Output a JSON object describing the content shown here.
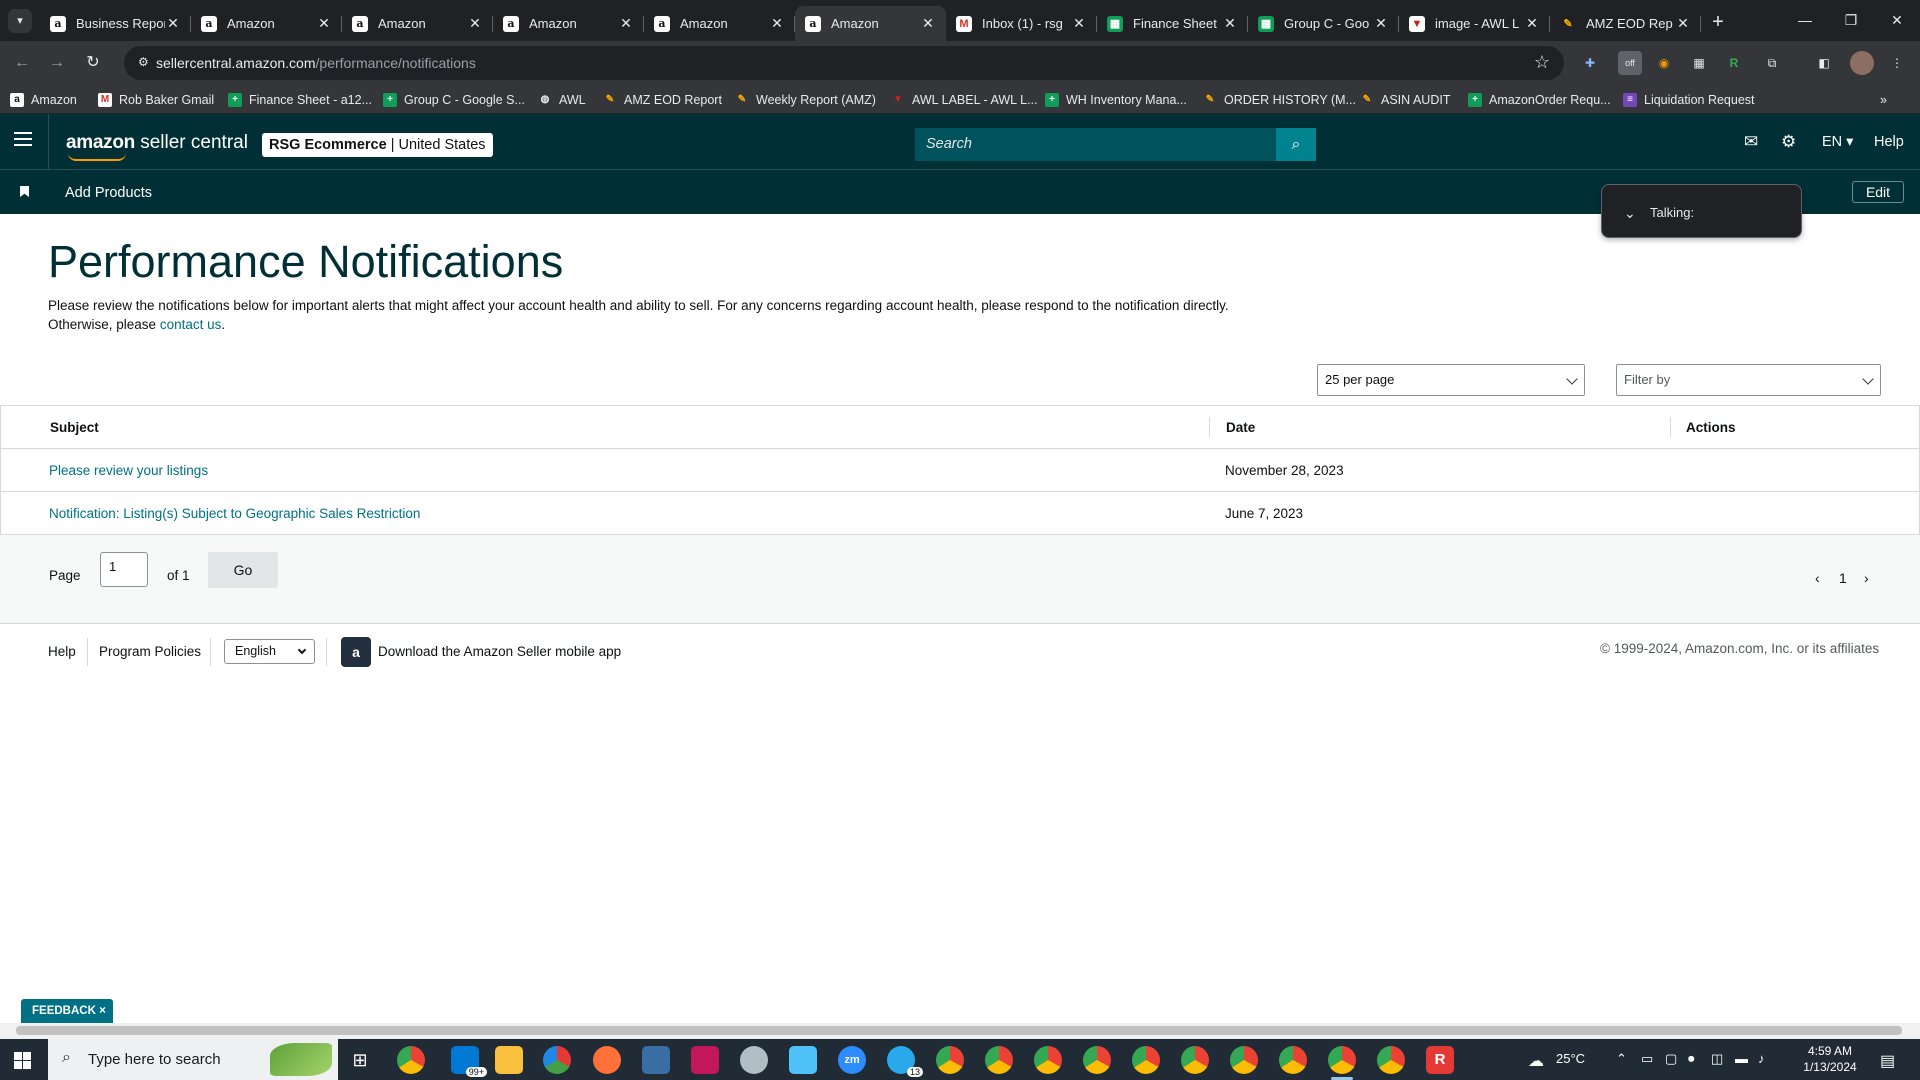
{
  "browser": {
    "tabs": [
      {
        "title": "Business Repor",
        "favicon": "amazon-icon",
        "active": false
      },
      {
        "title": "Amazon",
        "favicon": "amazon-icon",
        "active": false
      },
      {
        "title": "Amazon",
        "favicon": "amazon-icon",
        "active": false
      },
      {
        "title": "Amazon",
        "favicon": "amazon-icon",
        "active": false
      },
      {
        "title": "Amazon",
        "favicon": "amazon-icon",
        "active": false
      },
      {
        "title": "Amazon",
        "favicon": "amazon-icon",
        "active": true
      },
      {
        "title": "Inbox (1) - rsg",
        "favicon": "gmail-icon",
        "active": false
      },
      {
        "title": "Finance Sheet",
        "favicon": "sheets-icon",
        "active": false
      },
      {
        "title": "Group C - Goo",
        "favicon": "sheets-icon",
        "active": false
      },
      {
        "title": "image - AWL L",
        "favicon": "awl-icon",
        "active": false
      },
      {
        "title": "AMZ EOD Rep",
        "favicon": "slides-icon",
        "active": false
      }
    ],
    "url_domain": "sellercentral.amazon.com",
    "url_path": "/performance/notifications",
    "bookmarks": [
      {
        "label": "Amazon",
        "icon": "amazon-icon"
      },
      {
        "label": "Rob Baker Gmail",
        "icon": "gmail-icon"
      },
      {
        "label": "Finance Sheet - a12...",
        "icon": "sheets-icon"
      },
      {
        "label": "Group C - Google S...",
        "icon": "sheets-icon"
      },
      {
        "label": "AWL",
        "icon": "globe-icon"
      },
      {
        "label": "AMZ EOD Report",
        "icon": "slides-icon"
      },
      {
        "label": "Weekly Report (AMZ)",
        "icon": "slides-icon"
      },
      {
        "label": "AWL LABEL - AWL L...",
        "icon": "awl-icon"
      },
      {
        "label": "WH Inventory Mana...",
        "icon": "sheets-icon"
      },
      {
        "label": "ORDER HISTORY (M...",
        "icon": "slides-icon"
      },
      {
        "label": "ASIN AUDIT",
        "icon": "slides-icon"
      },
      {
        "label": "AmazonOrder Requ...",
        "icon": "sheets-icon"
      },
      {
        "label": "Liquidation Request",
        "icon": "forms-icon"
      }
    ]
  },
  "header": {
    "logo_brand": "amazon",
    "logo_suffix": " seller central",
    "merchant_name": "RSG Ecommerce",
    "merchant_region": "United States",
    "search_placeholder": "Search",
    "language": "EN",
    "help": "Help"
  },
  "subnav": {
    "add_products": "Add Products",
    "edit": "Edit"
  },
  "talking_popup": {
    "label": "Talking:"
  },
  "page": {
    "title": "Performance Notifications",
    "intro": "Please review the notifications below for important alerts that might affect your account health and ability to sell. For any concerns regarding account health, please respond to the notification directly. Otherwise, please ",
    "contact_link": "contact us",
    "intro_end": ".",
    "per_page": "25 per page",
    "filter_placeholder": "Filter by",
    "columns": {
      "subject": "Subject",
      "date": "Date",
      "actions": "Actions"
    },
    "rows": [
      {
        "subject": "Please review your listings",
        "date": "November 28, 2023"
      },
      {
        "subject": "Notification: Listing(s) Subject to Geographic Sales Restriction",
        "date": "June 7, 2023"
      }
    ],
    "pager": {
      "page_label": "Page",
      "page_value": "1",
      "of_label": "of 1",
      "go": "Go",
      "current": "1"
    }
  },
  "footer": {
    "help": "Help",
    "program_policies": "Program Policies",
    "language": "English",
    "download_app": "Download the Amazon Seller mobile app",
    "copyright": "© 1999-2024, Amazon.com, Inc. or its affiliates"
  },
  "feedback": {
    "label": "FEEDBACK ×"
  },
  "taskbar": {
    "search_placeholder": "Type here to search",
    "mail_badge": "99+",
    "telegram_badge": "13",
    "temperature": "25°C",
    "time": "4:59 AM",
    "date": "1/13/2024"
  },
  "colors": {
    "header_bg": "#002f36",
    "search_bg": "#00535c",
    "search_button": "#00828f",
    "link": "#007185",
    "title": "#002f36"
  }
}
